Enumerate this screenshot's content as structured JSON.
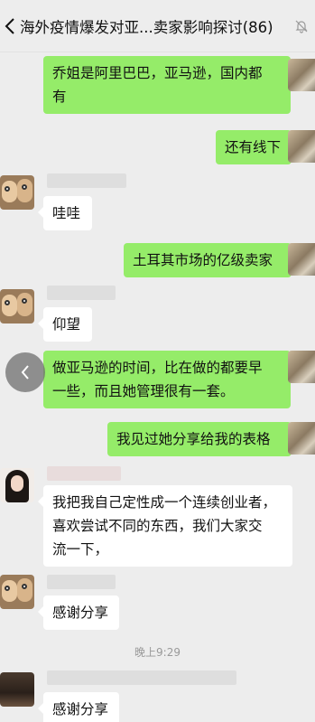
{
  "header": {
    "back_icon": "chevron-left-icon",
    "title": "海外疫情爆发对亚...卖家影响探讨(86)",
    "mute_icon": "bell-muted-icon"
  },
  "messages": [
    {
      "side": "out",
      "text_lines": [
        "乔姐是阿里巴巴，亚马逊，国内都",
        "有"
      ]
    },
    {
      "side": "out",
      "text": "还有线下"
    },
    {
      "side": "in",
      "text": "哇哇"
    },
    {
      "side": "out",
      "text": "土耳其市场的亿级卖家"
    },
    {
      "side": "in",
      "text": "仰望"
    },
    {
      "side": "out",
      "text_lines": [
        "做亚马逊的时间，比在做的都要早",
        "一些，而且她管理很有一套。"
      ]
    },
    {
      "side": "out",
      "text": "我见过她分享给我的表格"
    },
    {
      "side": "in",
      "text_lines": [
        "我把我自己定性成一个连续创业者，",
        "喜欢尝试不同的东西，我们大家交",
        "流一下，"
      ]
    },
    {
      "side": "in",
      "text": "感谢分享"
    },
    {
      "side": "in",
      "text": "感谢分享"
    }
  ],
  "timestamp": "晚上9:29",
  "float_button_icon": "chevron-left-icon"
}
